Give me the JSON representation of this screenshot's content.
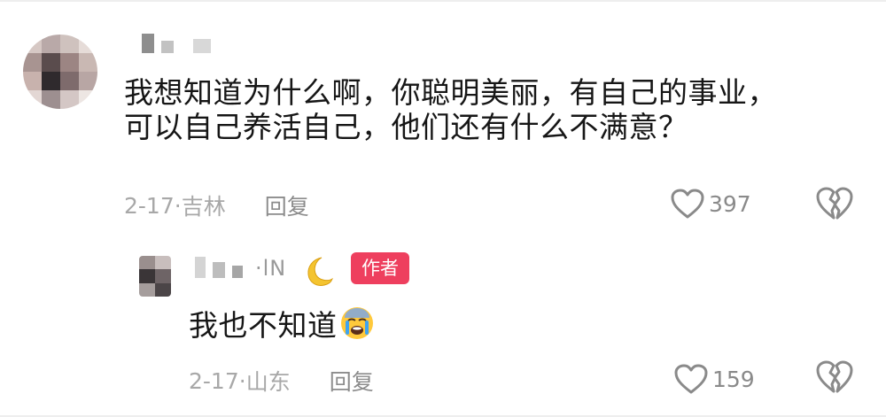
{
  "comments": [
    {
      "text_line1": "我想知道为什么啊，你聪明美丽，有自己的事业，",
      "text_line2": "可以自己养活自己，他们还有什么不满意？",
      "date": "2-17·",
      "location": "吉林",
      "reply_label": "回复",
      "likes": "397"
    },
    {
      "author_name_visible": "·lN",
      "author_badge": "作者",
      "text": "我也不知道",
      "date": "2-17·",
      "location": "山东",
      "reply_label": "回复",
      "likes": "159"
    }
  ],
  "colors": {
    "text": "#161616",
    "meta": "#a8a8a8",
    "badge": "#ee3f5e"
  },
  "icons": [
    "heart-outline-icon",
    "broken-heart-icon",
    "crescent-moon-emoji",
    "crying-face-emoji"
  ]
}
